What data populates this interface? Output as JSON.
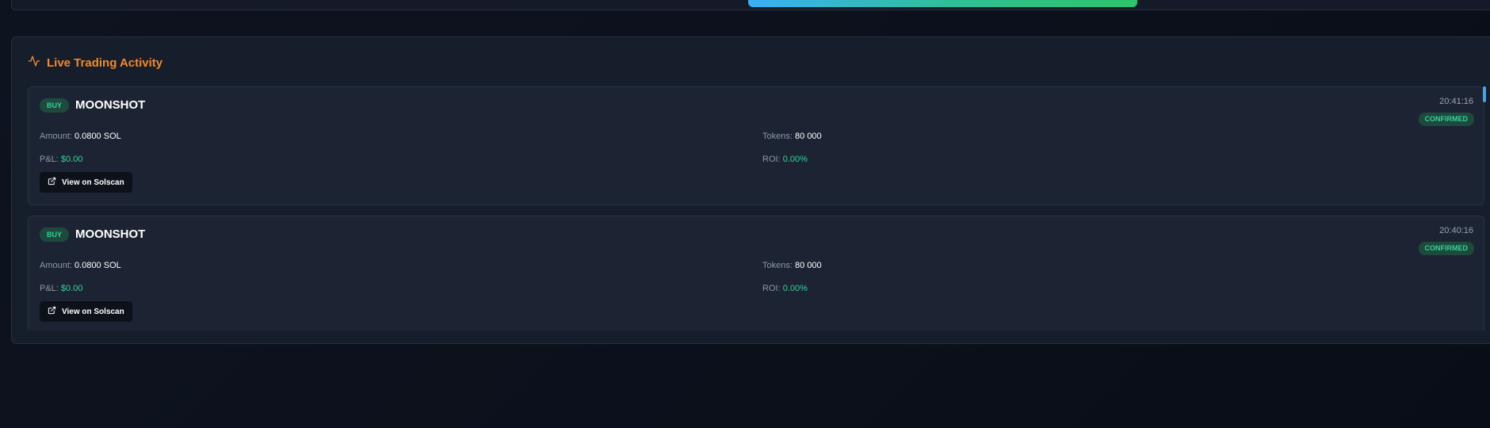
{
  "panel": {
    "title": "Live Trading Activity",
    "icon": "activity-icon",
    "accent_color": "#f08a2b"
  },
  "trades": [
    {
      "side": "BUY",
      "token": "MOONSHOT",
      "time": "20:41:16",
      "status": "CONFIRMED",
      "amount_label": "Amount:",
      "amount": "0.0800 SOL",
      "tokens_label": "Tokens:",
      "tokens": "80 000",
      "pnl_label": "P&L:",
      "pnl": "$0.00",
      "roi_label": "ROI:",
      "roi": "0.00%",
      "link_label": "View on Solscan"
    },
    {
      "side": "BUY",
      "token": "MOONSHOT",
      "time": "20:40:16",
      "status": "CONFIRMED",
      "amount_label": "Amount:",
      "amount": "0.0800 SOL",
      "tokens_label": "Tokens:",
      "tokens": "80 000",
      "pnl_label": "P&L:",
      "pnl": "$0.00",
      "roi_label": "ROI:",
      "roi": "0.00%",
      "link_label": "View on Solscan"
    }
  ],
  "colors": {
    "buy_green": "#34d399",
    "progress_start": "#3bb0f3",
    "progress_end": "#2ec46a"
  }
}
